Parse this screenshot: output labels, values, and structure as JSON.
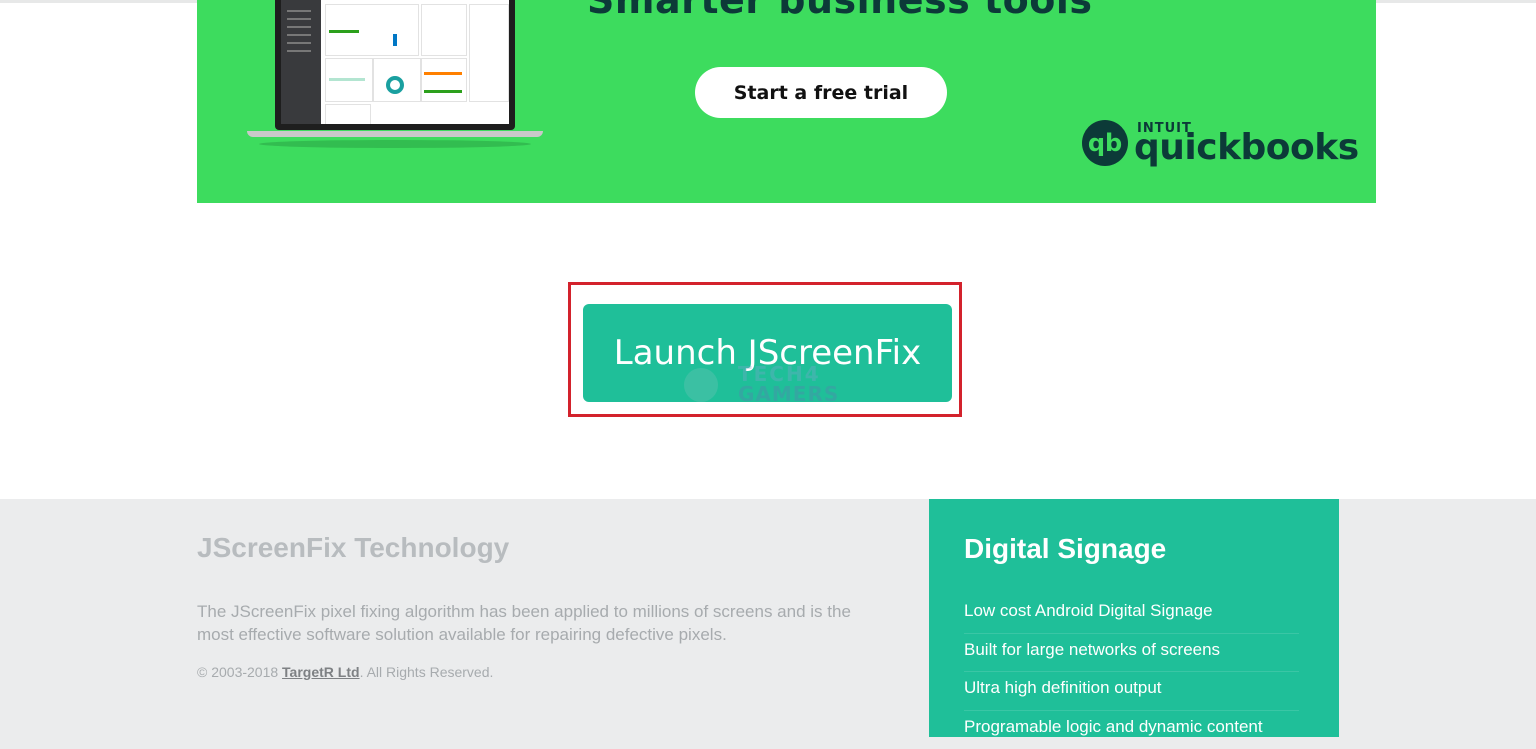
{
  "ad": {
    "headline": "Smarter business tools",
    "cta_label": "Start a free trial",
    "logo_mark": "qb",
    "logo_top": "INTUIT",
    "logo_word": "quickbooks",
    "colors": {
      "background": "#3ddc5e",
      "text": "#0c3a38"
    }
  },
  "launch": {
    "label": "Launch JScreenFix",
    "color": "#1fbf99",
    "highlight_color": "#d3222c"
  },
  "watermark": {
    "line1": "TECH4",
    "line2": "GAMERS"
  },
  "footer": {
    "title": "JScreenFix Technology",
    "description": "The JScreenFix pixel fixing algorithm has been applied to millions of screens and is the most effective software solution available for repairing defective pixels.",
    "copyright_prefix": "© 2003-2018 ",
    "company_link": "TargetR Ltd",
    "copyright_suffix": ". All Rights Reserved."
  },
  "signage": {
    "title": "Digital Signage",
    "items": [
      "Low cost Android Digital Signage",
      "Built for large networks of screens",
      "Ultra high definition output",
      "Programable logic and dynamic content"
    ]
  }
}
